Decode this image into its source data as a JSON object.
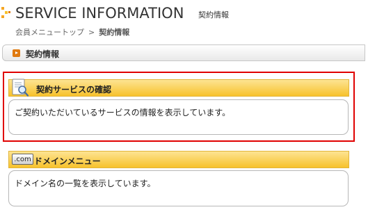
{
  "header": {
    "title": "SERVICE INFORMATION",
    "subtitle": "契約情報"
  },
  "breadcrumb": {
    "home": "会員メニュートップ",
    "separator": ">",
    "current": "契約情報"
  },
  "section": {
    "label": "契約情報"
  },
  "cards": [
    {
      "title": "契約サービスの確認",
      "description": "ご契約いただいているサービスの情報を表示しています。",
      "icon": "document-magnifier-icon"
    },
    {
      "badge": ".com",
      "title": "ドメインメニュー",
      "description": "ドメイン名の一覧を表示しています。",
      "icon": "dotcom-badge-icon"
    }
  ],
  "colors": {
    "accent_orange": "#e07a10",
    "header_gold": "#f7c22c",
    "highlight_red": "#e00000"
  }
}
